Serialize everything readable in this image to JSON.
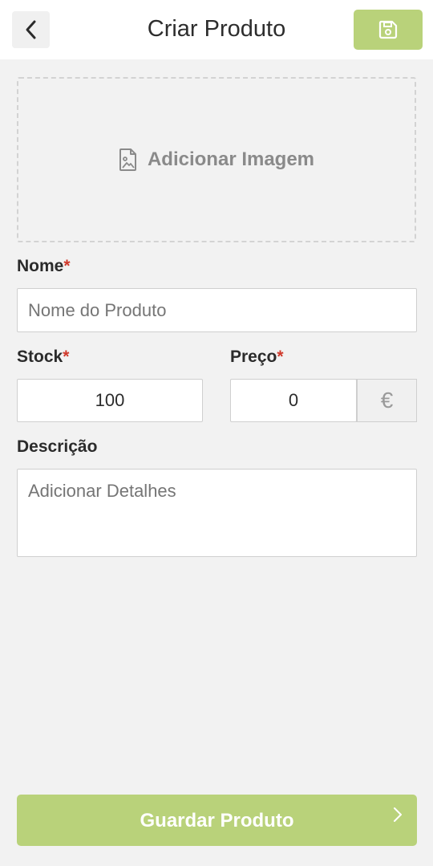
{
  "header": {
    "title": "Criar Produto",
    "back_icon": "chevron-left-icon",
    "save_icon": "floppy-disk-icon"
  },
  "image_upload": {
    "label": "Adicionar Imagem",
    "icon": "image-file-icon"
  },
  "form": {
    "name": {
      "label": "Nome",
      "required_mark": "*",
      "placeholder": "Nome do Produto",
      "value": ""
    },
    "stock": {
      "label": "Stock",
      "required_mark": "*",
      "value": "100"
    },
    "price": {
      "label": "Preço",
      "required_mark": "*",
      "value": "0",
      "currency": "€"
    },
    "description": {
      "label": "Descrição",
      "placeholder": "Adicionar Detalhes",
      "value": ""
    }
  },
  "footer": {
    "submit_label": "Guardar Produto",
    "submit_icon": "chevron-right-icon"
  },
  "colors": {
    "accent": "#b9d27a",
    "required": "#d0392b",
    "background": "#f2f2f2"
  }
}
